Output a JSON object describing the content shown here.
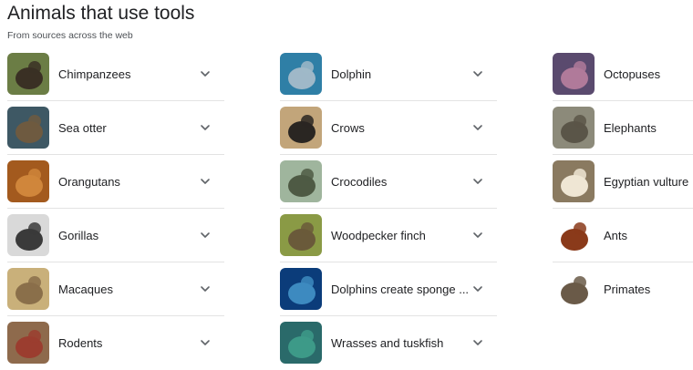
{
  "header": {
    "title": "Animals that use tools",
    "subtitle": "From sources across the web"
  },
  "columns": [
    {
      "items": [
        {
          "label": "Chimpanzees",
          "icon": "chimpanzee-thumbnail",
          "expandable": true,
          "colors": [
            "#6b7d45",
            "#3a3024"
          ]
        },
        {
          "label": "Sea otter",
          "icon": "sea-otter-thumbnail",
          "expandable": true,
          "colors": [
            "#3e5864",
            "#6e5a40"
          ]
        },
        {
          "label": "Orangutans",
          "icon": "orangutan-thumbnail",
          "expandable": true,
          "colors": [
            "#a35a1e",
            "#d0863b"
          ]
        },
        {
          "label": "Gorillas",
          "icon": "gorilla-thumbnail",
          "expandable": true,
          "colors": [
            "#d9d9d9",
            "#3a3a3a"
          ]
        },
        {
          "label": "Macaques",
          "icon": "macaque-thumbnail",
          "expandable": true,
          "colors": [
            "#c9b07a",
            "#8a6f4a"
          ]
        },
        {
          "label": "Rodents",
          "icon": "rodent-thumbnail",
          "expandable": true,
          "colors": [
            "#8e6a4c",
            "#9b3d2f"
          ]
        }
      ]
    },
    {
      "items": [
        {
          "label": "Dolphin",
          "icon": "dolphin-thumbnail",
          "expandable": true,
          "colors": [
            "#2f7fa6",
            "#9fb8c8"
          ]
        },
        {
          "label": "Crows",
          "icon": "crow-thumbnail",
          "expandable": true,
          "colors": [
            "#c2a57a",
            "#2a2622"
          ]
        },
        {
          "label": "Crocodiles",
          "icon": "crocodile-thumbnail",
          "expandable": true,
          "colors": [
            "#9fb59d",
            "#4e5a44"
          ]
        },
        {
          "label": "Woodpecker finch",
          "icon": "woodpecker-finch-thumbnail",
          "expandable": true,
          "colors": [
            "#8a9a45",
            "#6a5a3a"
          ]
        },
        {
          "label": "Dolphins create sponge ...",
          "icon": "dolphin-sponge-thumbnail",
          "expandable": true,
          "colors": [
            "#0b3c7a",
            "#3d8ac0"
          ]
        },
        {
          "label": "Wrasses and tuskfish",
          "icon": "wrasse-thumbnail",
          "expandable": true,
          "colors": [
            "#2a6a6a",
            "#3d9a88"
          ]
        }
      ]
    },
    {
      "items": [
        {
          "label": "Octopuses",
          "icon": "octopus-thumbnail",
          "expandable": false,
          "colors": [
            "#5a4a6e",
            "#b07a9a"
          ]
        },
        {
          "label": "Elephants",
          "icon": "elephant-thumbnail",
          "expandable": false,
          "colors": [
            "#8c8a7a",
            "#5a5548"
          ]
        },
        {
          "label": "Egyptian vulture",
          "icon": "egyptian-vulture-thumbnail",
          "expandable": false,
          "colors": [
            "#8a7a60",
            "#efe6d4"
          ]
        },
        {
          "label": "Ants",
          "icon": "ant-thumbnail",
          "expandable": false,
          "colors": [
            "#ffffff",
            "#8a3a1a"
          ]
        },
        {
          "label": "Primates",
          "icon": "primates-thumbnail",
          "expandable": false,
          "colors": [
            "#ffffff",
            "#6a5a48"
          ]
        }
      ]
    }
  ],
  "icons": {
    "chevron": "chevron-down-icon",
    "chevron_color": "#5f6368"
  }
}
